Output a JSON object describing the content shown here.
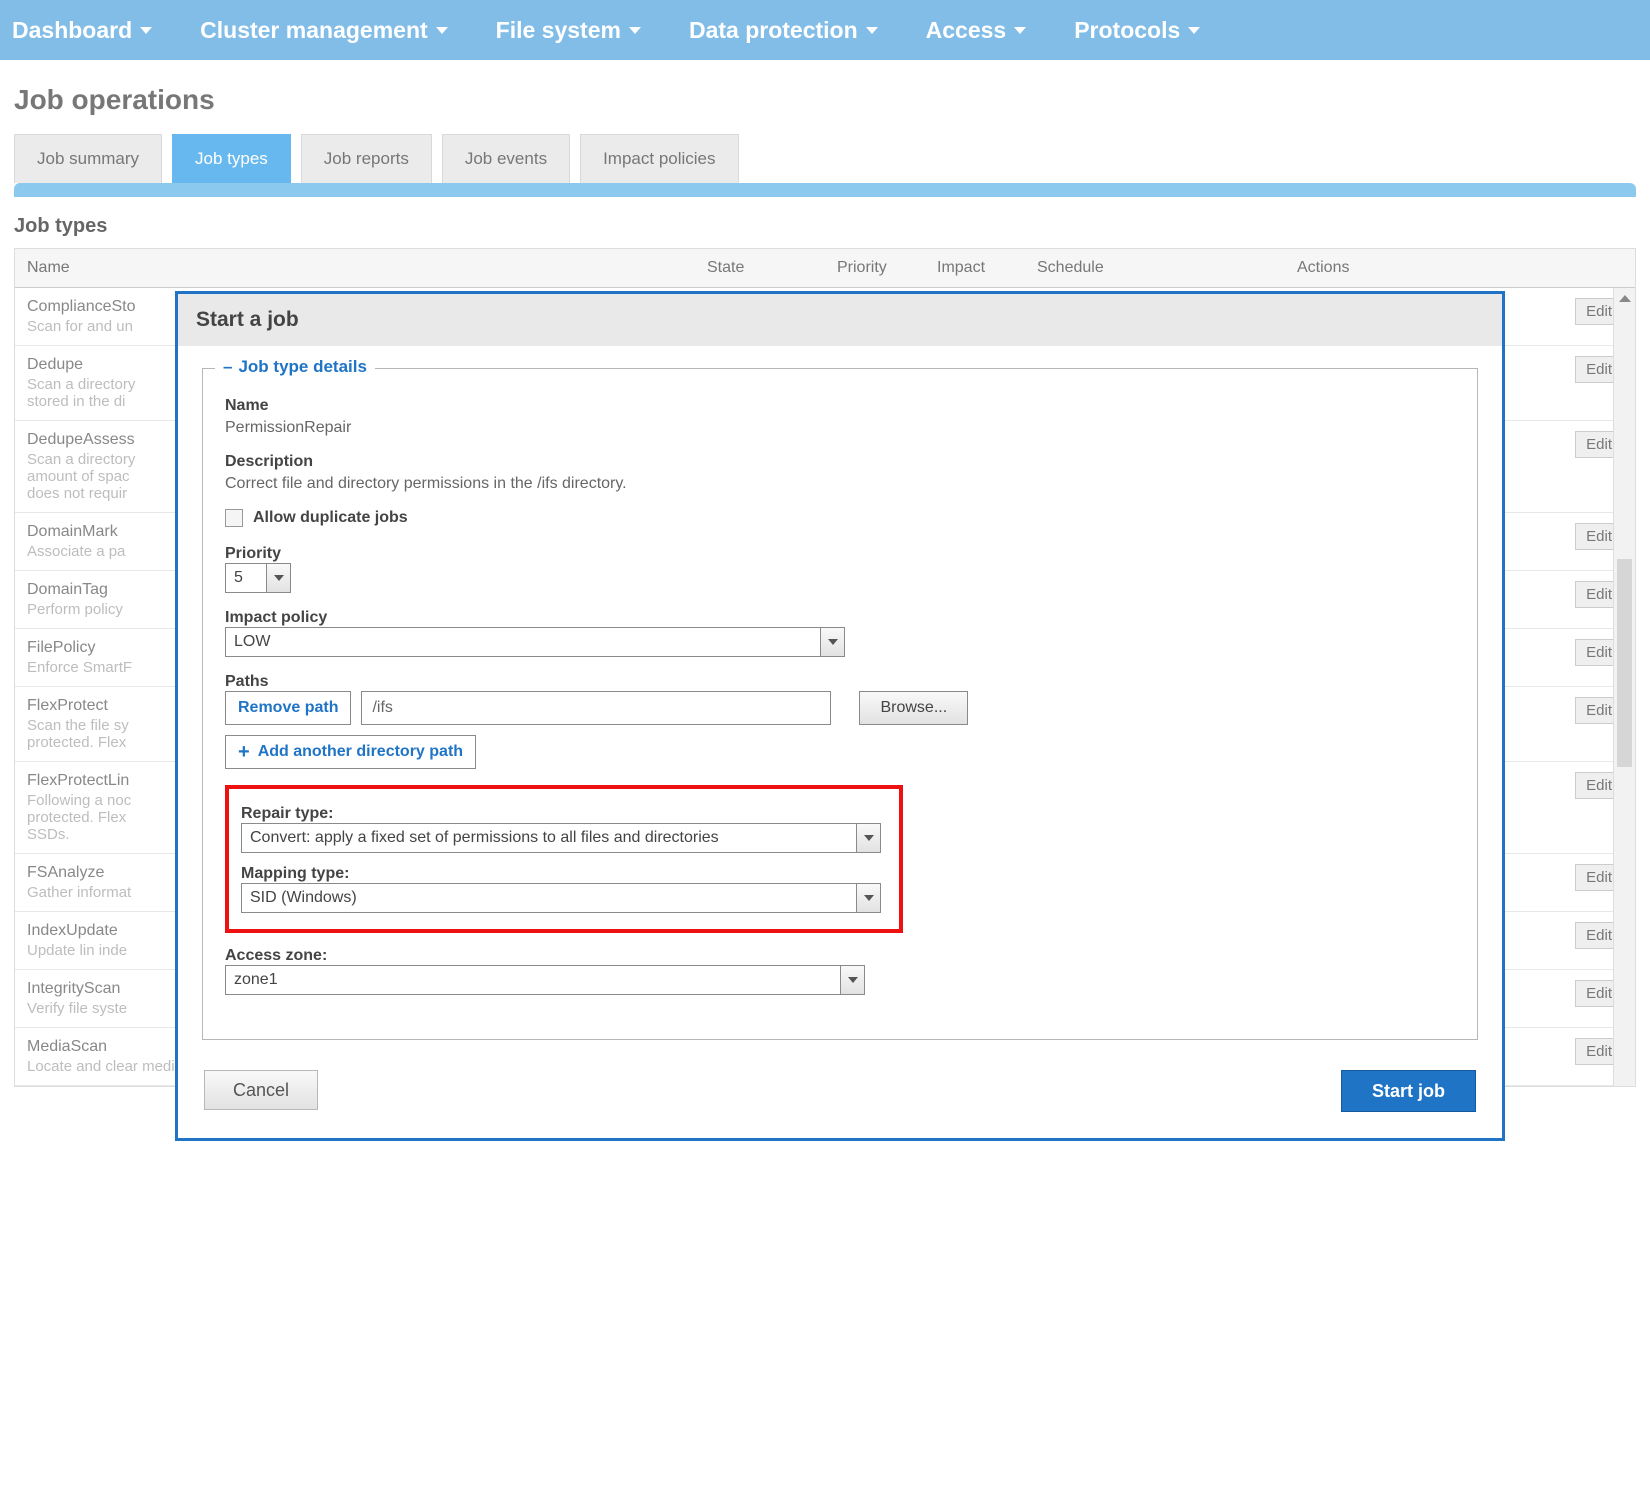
{
  "nav": {
    "items": [
      {
        "label": "Dashboard"
      },
      {
        "label": "Cluster management"
      },
      {
        "label": "File system"
      },
      {
        "label": "Data protection"
      },
      {
        "label": "Access"
      },
      {
        "label": "Protocols"
      }
    ]
  },
  "page_title": "Job operations",
  "tabs": [
    {
      "label": "Job summary"
    },
    {
      "label": "Job types"
    },
    {
      "label": "Job reports"
    },
    {
      "label": "Job events"
    },
    {
      "label": "Impact policies"
    }
  ],
  "active_tab_index": 1,
  "section_title": "Job types",
  "columns": {
    "name": "Name",
    "state": "State",
    "priority": "Priority",
    "impact": "Impact",
    "schedule": "Schedule",
    "actions": "Actions"
  },
  "edit_label": "Edit",
  "jobs": [
    {
      "name": "ComplianceSto",
      "desc": "Scan for and un"
    },
    {
      "name": "Dedupe",
      "desc": "Scan a directory\nstored in the di"
    },
    {
      "name": "DedupeAssess",
      "desc": "Scan a directory\namount of spac\ndoes not requir"
    },
    {
      "name": "DomainMark",
      "desc": "Associate a pa"
    },
    {
      "name": "DomainTag",
      "desc": "Perform policy"
    },
    {
      "name": "FilePolicy",
      "desc": "Enforce SmartF"
    },
    {
      "name": "FlexProtect",
      "desc": "Scan the file sy\nprotected. Flex"
    },
    {
      "name": "FlexProtectLin",
      "desc": "Following a noc\nprotected. Flex\nSSDs."
    },
    {
      "name": "FSAnalyze",
      "desc": "Gather informat"
    },
    {
      "name": "IndexUpdate",
      "desc": "Update lin inde"
    },
    {
      "name": "IntegrityScan",
      "desc": "Verify file syste"
    },
    {
      "name": "MediaScan",
      "desc": "Locate and clear media-level errors from disks."
    }
  ],
  "modal": {
    "title": "Start a job",
    "legend": "Job type details",
    "fields": {
      "name_label": "Name",
      "name_value": "PermissionRepair",
      "desc_label": "Description",
      "desc_value": "Correct file and directory permissions in the /ifs directory.",
      "allow_dup_label": "Allow duplicate jobs",
      "allow_dup_checked": false,
      "priority_label": "Priority",
      "priority_value": "5",
      "impact_label": "Impact policy",
      "impact_value": "LOW",
      "paths_label": "Paths",
      "remove_path_label": "Remove path",
      "path_value": "/ifs",
      "browse_label": "Browse...",
      "add_path_label": "Add another directory path",
      "repair_label": "Repair type:",
      "repair_value": "Convert: apply a fixed set of permissions to all files and directories",
      "mapping_label": "Mapping type:",
      "mapping_value": "SID (Windows)",
      "zone_label": "Access zone:",
      "zone_value": "zone1"
    },
    "buttons": {
      "cancel": "Cancel",
      "start": "Start job"
    }
  },
  "colors": {
    "accent": "#1f74c6",
    "nav": "#82bde8"
  }
}
